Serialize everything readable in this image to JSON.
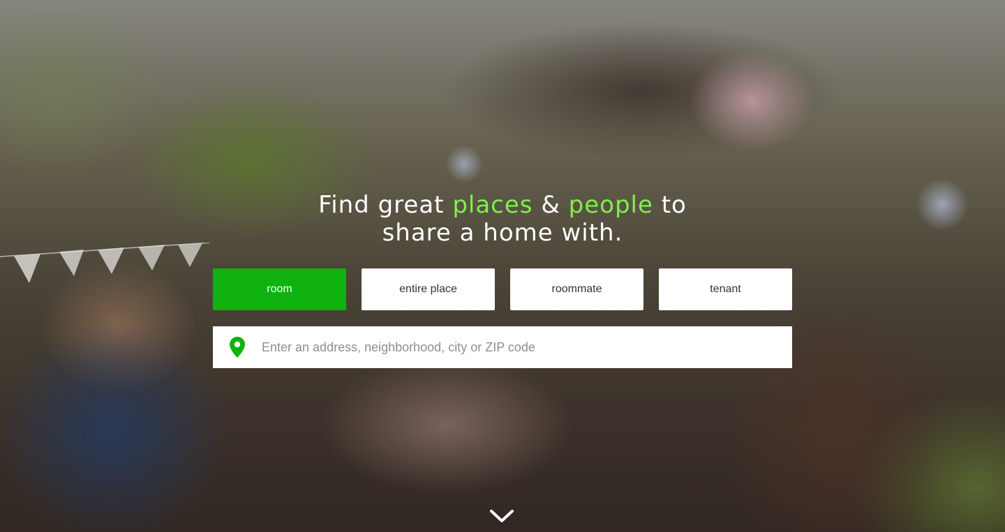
{
  "hero": {
    "headline": {
      "part1": "Find great ",
      "highlight1": "places",
      "part2": " & ",
      "highlight2": "people",
      "part3": " to",
      "line2": "share a home with."
    },
    "background_icon": "party-photo"
  },
  "tabs": [
    {
      "label": "room",
      "active": true
    },
    {
      "label": "entire place",
      "active": false
    },
    {
      "label": "roommate",
      "active": false
    },
    {
      "label": "tenant",
      "active": false
    }
  ],
  "search": {
    "placeholder": "Enter an address, neighborhood, city or ZIP code",
    "value": "",
    "icon": "location-pin-icon"
  },
  "scroll_icon": "chevron-down-icon",
  "colors": {
    "accent": "#0fb20f",
    "highlight_text": "#7ef04a",
    "tab_background": "#ffffff"
  }
}
